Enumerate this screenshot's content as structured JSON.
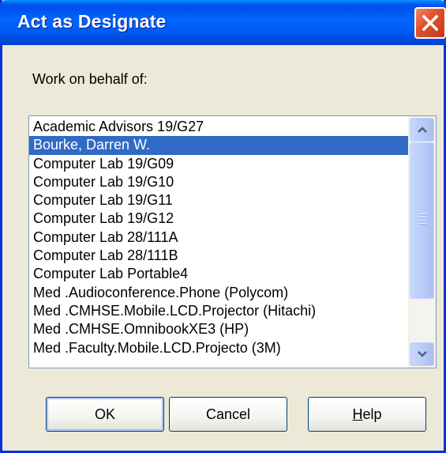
{
  "window": {
    "title": "Act as Designate"
  },
  "prompt": {
    "label": "Work on behalf of:"
  },
  "list": {
    "items": [
      "Academic Advisors 19/G27",
      "Bourke, Darren W.",
      "Computer Lab 19/G09",
      "Computer Lab 19/G10",
      "Computer Lab 19/G11",
      "Computer Lab 19/G12",
      "Computer Lab 28/111A",
      "Computer Lab 28/111B",
      "Computer Lab Portable4",
      "Med .Audioconference.Phone  (Polycom)",
      "Med .CMHSE.Mobile.LCD.Projector  (Hitachi)",
      "Med .CMHSE.OmnibookXE3  (HP)",
      "Med .Faculty.Mobile.LCD.Projecto  (3M)"
    ],
    "selected_index": 1
  },
  "buttons": {
    "ok": "OK",
    "cancel": "Cancel",
    "help_underlined": "H",
    "help_rest": "elp"
  },
  "icons": {
    "close": "close-x-icon",
    "scroll_up": "chevron-up-icon",
    "scroll_down": "chevron-down-icon",
    "grip": "scroll-grip-icon"
  },
  "colors": {
    "titlebar": "#0058ee",
    "selection": "#316ac5",
    "close": "#e0542c",
    "dialog_bg": "#ece9d8"
  }
}
